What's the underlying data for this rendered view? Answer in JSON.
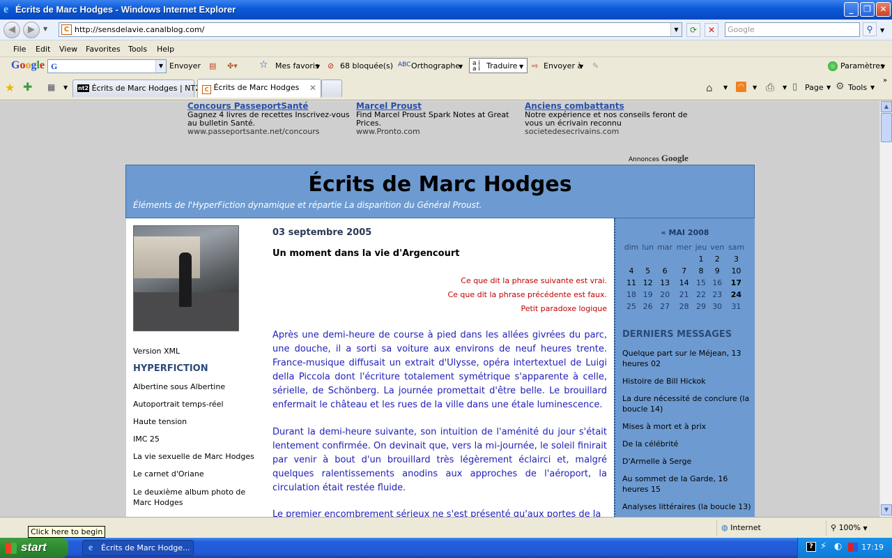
{
  "window": {
    "title": "Écrits de Marc Hodges - Windows Internet Explorer"
  },
  "address": {
    "url": "http://sensdelavie.canalblog.com/",
    "search_placeholder": "Google"
  },
  "menu": [
    "File",
    "Edit",
    "View",
    "Favorites",
    "Tools",
    "Help"
  ],
  "google_toolbar": {
    "logo": "Google",
    "query_value": "G",
    "envoyer": "Envoyer",
    "mes_favoris": "Mes favoris",
    "bloquees": "68 bloquée(s)",
    "orthographe": "Orthographe",
    "traduire": "Traduire",
    "envoyer_a": "Envoyer à",
    "parametres": "Paramètres"
  },
  "tabs": [
    {
      "label": "Écrits de Marc Hodges | NT2",
      "icon_text": "nt2"
    },
    {
      "label": "Écrits de Marc Hodges"
    }
  ],
  "command_bar": {
    "page": "Page",
    "tools": "Tools"
  },
  "ads": [
    {
      "title": "Concours PasseportSanté",
      "text": "Gagnez 4 livres de recettes Inscrivez-vous au bulletin Santé.",
      "url": "www.passeportsante.net/concours"
    },
    {
      "title": "Marcel Proust",
      "text": "Find Marcel Proust Spark Notes at Great Prices.",
      "url": "www.Pronto.com"
    },
    {
      "title": "Anciens combattants",
      "text": "Notre expérience et nos conseils feront de vous un écrivain reconnu",
      "url": "societedesecrivains.com"
    }
  ],
  "annonces": {
    "prefix": "Annonces",
    "brand": "Google"
  },
  "blog": {
    "title": "Écrits de Marc Hodges",
    "subtitle": "Éléments de l'HyperFiction dynamique et répartie La disparition du Général Proust."
  },
  "sidebar_left": {
    "xml": "Version XML",
    "heading": "HYPERFICTION",
    "links": [
      "Albertine sous Albertine",
      "Autoportrait temps-réel",
      "Haute tension",
      "IMC 25",
      "La vie sexuelle de Marc Hodges",
      "Le carnet d'Oriane",
      "Le deuxième album photo de Marc Hodges"
    ]
  },
  "post": {
    "date": "03 septembre 2005",
    "title": "Un moment dans la vie d'Argencourt",
    "epigraph": [
      "Ce que dit la phrase suivante est vrai.",
      "Ce que dit la phrase précédente est faux.",
      "Petit paradoxe logique"
    ],
    "paragraphs": [
      "Après une demi-heure de course à pied dans les allées givrées du parc, une douche, il a sorti sa voiture aux environs de neuf heures trente. France-musique diffusait un extrait d'Ulysse, opéra intertextuel de Luigi della Piccola dont l'écriture totalement symétrique s'apparente à celle, sérielle, de Schönberg. La journée promettait d'être belle. Le brouillard enfermait le château et les rues de la ville dans une étale luminescence.",
      "Durant la demi-heure suivante, son intuition de l'aménité du jour s'était lentement confirmée. On devinait que, vers la mi-journée, le soleil finirait par venir à bout d'un brouillard très légèrement éclairci et, malgré quelques ralentissements anodins aux approches de l'aéroport, la circulation était restée fluide.",
      "Le premier encombrement sérieux ne s'est présenté qu'aux portes de la"
    ]
  },
  "calendar": {
    "caption": "« MAI 2008",
    "headers": [
      "dim",
      "lun",
      "mar",
      "mer",
      "jeu",
      "ven",
      "sam"
    ],
    "weeks": [
      [
        "",
        "",
        "",
        "",
        "1",
        "2",
        "3"
      ],
      [
        "4",
        "5",
        "6",
        "7",
        "8",
        "9",
        "10"
      ],
      [
        "11",
        "12",
        "13",
        "14",
        "15",
        "16",
        "17"
      ],
      [
        "18",
        "19",
        "20",
        "21",
        "22",
        "23",
        "24"
      ],
      [
        "25",
        "26",
        "27",
        "28",
        "29",
        "30",
        "31"
      ]
    ]
  },
  "derniers": {
    "heading": "DERNIERS MESSAGES",
    "items": [
      "Quelque part sur le Méjean, 13 heures 02",
      "Histoire de Bill Hickok",
      "La dure nécessité de conclure (la boucle 14)",
      "Mises à mort et à prix",
      "De la célébrité",
      "D'Armelle à Serge",
      "Au sommet de la Garde, 16 heures 15",
      "Analyses littéraires (la boucle 13)"
    ]
  },
  "status": {
    "tooltip": "Click here to begin",
    "zone": "Internet",
    "zoom": "100%"
  },
  "taskbar": {
    "start": "start",
    "item": "Écrits de Marc Hodge...",
    "clock": "17:19"
  },
  "colors": {
    "banner": "#6d9bd1",
    "link": "#2850a8",
    "post_text": "#2020b8",
    "epigraph": "#c00000"
  }
}
